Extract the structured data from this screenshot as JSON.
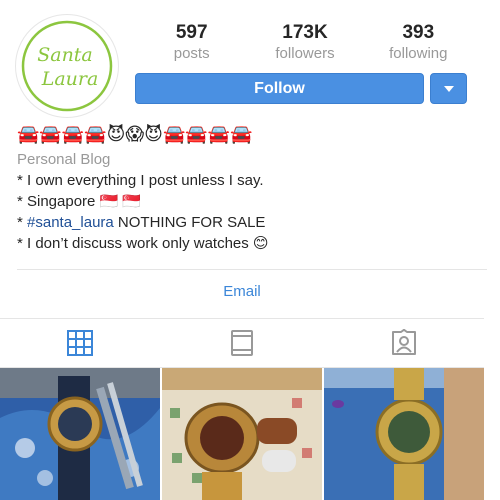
{
  "profile": {
    "logo_text_1": "Santa",
    "logo_text_2": "Laura",
    "stats": [
      {
        "num": "597",
        "label": "posts"
      },
      {
        "num": "173K",
        "label": "followers"
      },
      {
        "num": "393",
        "label": "following"
      }
    ],
    "follow_label": "Follow",
    "emoji_row": "🚘🚘🚘🚘😈😱😈🚘🚘🚘🚘",
    "category": "Personal Blog",
    "bio_lines": [
      "* I own everything I post unless I say.",
      "* Singapore 🇸🇬 🇸🇬",
      "NOTHING FOR SALE",
      "* I don’t discuss work only watches 😊"
    ],
    "bio_line3_prefix": "* ",
    "hashtag": "#santa_laura",
    "email_label": "Email"
  },
  "tabs": [
    {
      "name": "grid-icon"
    },
    {
      "name": "list-icon"
    },
    {
      "name": "tagged-icon"
    }
  ],
  "colors": {
    "follow_blue": "#4a90e2",
    "logo_green": "#8cc63f",
    "link_blue": "#3b86d8",
    "grid_active": "#3b86d8",
    "inactive_gray": "#999999"
  }
}
